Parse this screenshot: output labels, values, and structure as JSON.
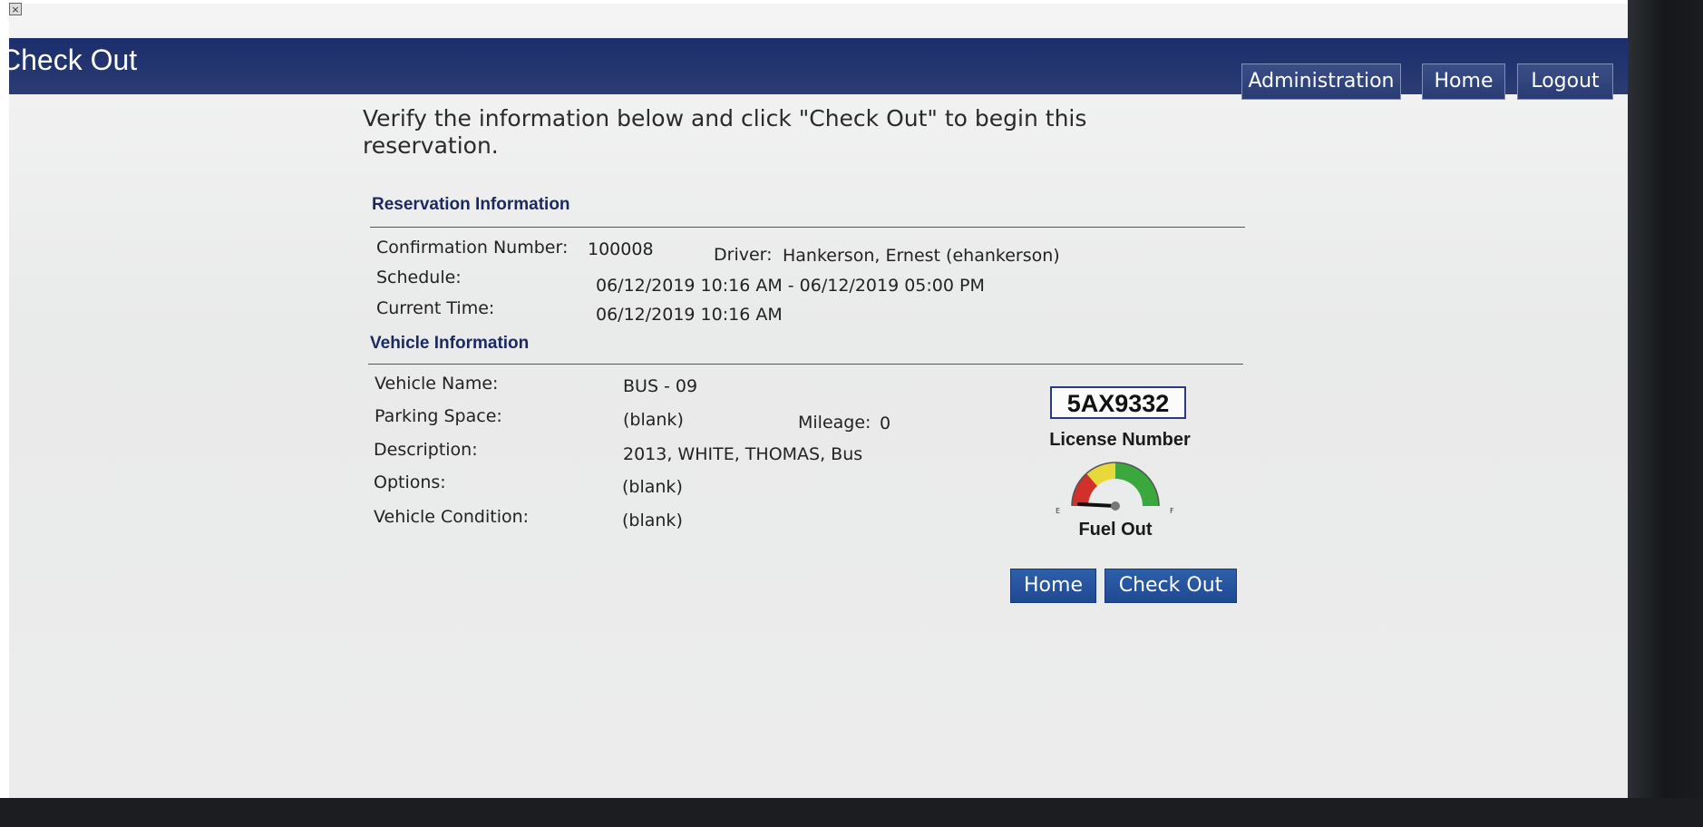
{
  "header": {
    "title": "Check Out",
    "nav": {
      "administration": "Administration",
      "home": "Home",
      "logout": "Logout"
    }
  },
  "instructions": "Verify the information below and click \"Check Out\" to begin this reservation.",
  "reservation": {
    "section_title": "Reservation Information",
    "confirmation_label": "Confirmation Number:",
    "confirmation_value": "100008",
    "driver_label": "Driver:",
    "driver_value": "Hankerson, Ernest (ehankerson)",
    "schedule_label": "Schedule:",
    "schedule_value": "06/12/2019 10:16 AM - 06/12/2019 05:00 PM",
    "current_time_label": "Current Time:",
    "current_time_value": "06/12/2019 10:16 AM"
  },
  "vehicle": {
    "section_title": "Vehicle Information",
    "name_label": "Vehicle Name:",
    "name_value": "BUS - 09",
    "parking_label": "Parking Space:",
    "parking_value": "(blank)",
    "mileage_label": "Mileage:",
    "mileage_value": "0",
    "description_label": "Description:",
    "description_value": "2013, WHITE, THOMAS, Bus",
    "options_label": "Options:",
    "options_value": "(blank)",
    "condition_label": "Vehicle Condition:",
    "condition_value": "(blank)",
    "license_plate": "5AX9332",
    "license_label": "License Number",
    "fuel": {
      "label": "Fuel Out",
      "empty_mark": "E",
      "full_mark": "F",
      "level": 0.0
    }
  },
  "actions": {
    "home": "Home",
    "check_out": "Check Out"
  },
  "colors": {
    "header": "#24366f",
    "action_button": "#2456a0",
    "section_title": "#1b2a5e"
  }
}
